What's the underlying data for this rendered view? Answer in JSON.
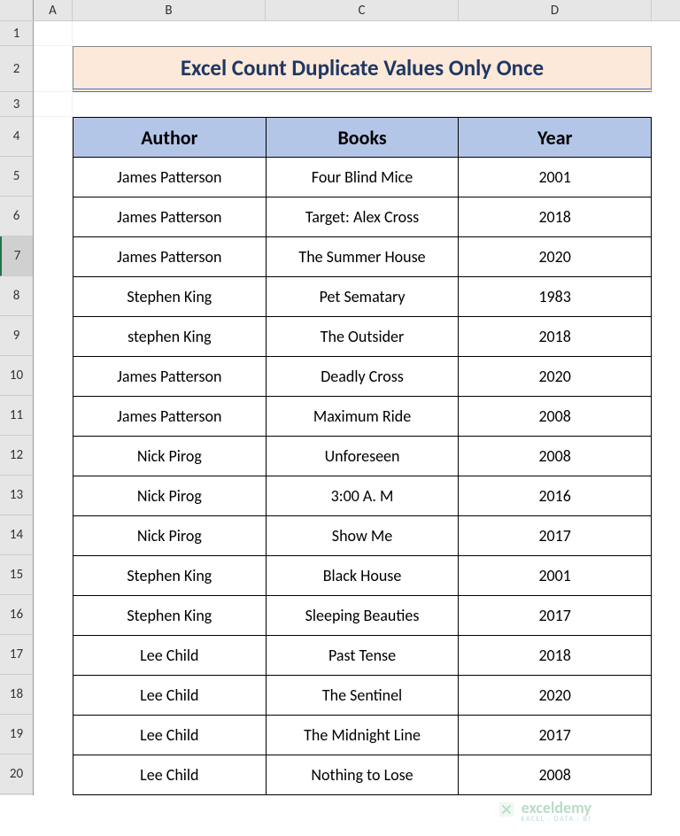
{
  "columns": [
    "A",
    "B",
    "C",
    "D"
  ],
  "rows": [
    "1",
    "2",
    "3",
    "4",
    "5",
    "6",
    "7",
    "8",
    "9",
    "10",
    "11",
    "12",
    "13",
    "14",
    "15",
    "16",
    "17",
    "18",
    "19",
    "20"
  ],
  "selectedRow": "7",
  "title": "Excel Count Duplicate Values Only Once",
  "headers": {
    "author": "Author",
    "books": "Books",
    "year": "Year"
  },
  "data": [
    {
      "author": "James Patterson",
      "book": "Four Blind Mice",
      "year": "2001"
    },
    {
      "author": "James Patterson",
      "book": "Target: Alex Cross",
      "year": "2018"
    },
    {
      "author": "James Patterson",
      "book": "The Summer House",
      "year": "2020"
    },
    {
      "author": "Stephen King",
      "book": "Pet Sematary",
      "year": "1983"
    },
    {
      "author": "stephen King",
      "book": "The Outsider",
      "year": "2018"
    },
    {
      "author": "James Patterson",
      "book": "Deadly Cross",
      "year": "2020"
    },
    {
      "author": "James Patterson",
      "book": "Maximum Ride",
      "year": "2008"
    },
    {
      "author": "Nick Pirog",
      "book": "Unforeseen",
      "year": "2008"
    },
    {
      "author": "Nick Pirog",
      "book": "3:00 A. M",
      "year": "2016"
    },
    {
      "author": "Nick Pirog",
      "book": "Show Me",
      "year": "2017"
    },
    {
      "author": "Stephen King",
      "book": "Black House",
      "year": "2001"
    },
    {
      "author": "Stephen King",
      "book": "Sleeping Beauties",
      "year": "2017"
    },
    {
      "author": "Lee Child",
      "book": "Past Tense",
      "year": "2018"
    },
    {
      "author": "Lee Child",
      "book": "The Sentinel",
      "year": "2020"
    },
    {
      "author": "Lee Child",
      "book": "The Midnight Line",
      "year": "2017"
    },
    {
      "author": "Lee Child",
      "book": "Nothing to Lose",
      "year": "2008"
    }
  ],
  "watermark": {
    "main": "exceldemy",
    "sub": "EXCEL · DATA · BI"
  }
}
